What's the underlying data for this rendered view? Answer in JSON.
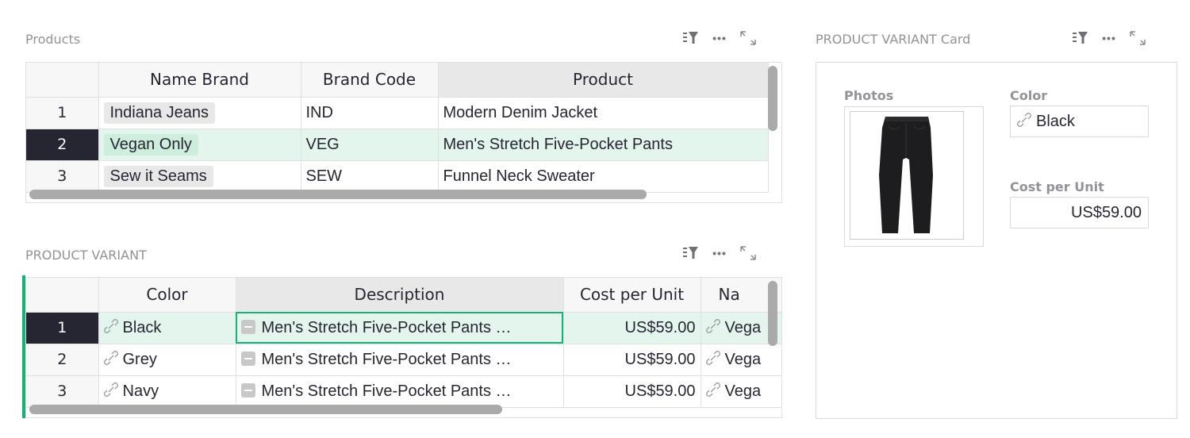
{
  "products_section": {
    "title": "Products",
    "columns": [
      "Name Brand",
      "Brand Code",
      "Product"
    ],
    "rows": [
      {
        "num": "1",
        "brand": "Indiana Jeans",
        "code": "IND",
        "product": "Modern Denim Jacket"
      },
      {
        "num": "2",
        "brand": "Vegan Only",
        "code": "VEG",
        "product": "Men's Stretch Five-Pocket Pants"
      },
      {
        "num": "3",
        "brand": "Sew it Seams",
        "code": "SEW",
        "product": "Funnel Neck Sweater"
      }
    ],
    "active_row": 2
  },
  "variant_section": {
    "title": "PRODUCT VARIANT",
    "columns": [
      "Color",
      "Description",
      "Cost per Unit",
      "Na"
    ],
    "rows": [
      {
        "num": "1",
        "color": "Black",
        "description": "Men's Stretch Five-Pocket Pants …",
        "cost": "US$59.00",
        "name": "Vega"
      },
      {
        "num": "2",
        "color": "Grey",
        "description": "Men's Stretch Five-Pocket Pants …",
        "cost": "US$59.00",
        "name": "Vega"
      },
      {
        "num": "3",
        "color": "Navy",
        "description": "Men's Stretch Five-Pocket Pants …",
        "cost": "US$59.00",
        "name": "Vega"
      }
    ],
    "active_row": 1
  },
  "card_section": {
    "title": "PRODUCT VARIANT Card",
    "photos_label": "Photos",
    "color_label": "Color",
    "color_value": "Black",
    "cost_label": "Cost per Unit",
    "cost_value": "US$59.00"
  },
  "icons": {
    "sort_filter": "sort-filter-icon",
    "more": "more-options-icon",
    "expand": "expand-icon",
    "link": "link-icon",
    "text_field": "text-field-icon"
  },
  "colors": {
    "accent": "#16b378",
    "active_row_bg": "#e4f5ee",
    "row_number_active_bg": "#262633",
    "header_bg": "#f7f7f7"
  }
}
